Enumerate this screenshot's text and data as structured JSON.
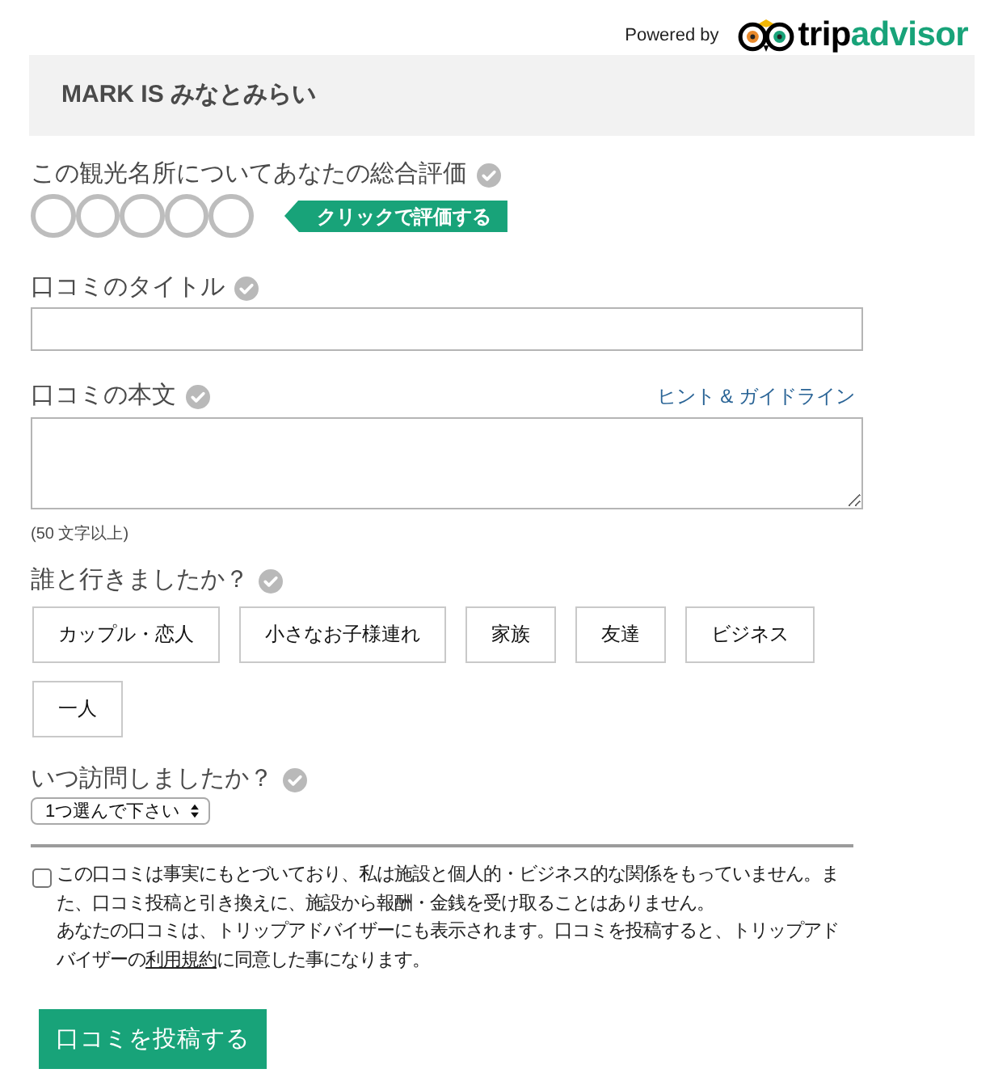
{
  "header": {
    "powered_by": "Powered by",
    "logo_parts": [
      "trip",
      "advisor"
    ]
  },
  "place": {
    "name": "MARK IS みなとみらい"
  },
  "rating": {
    "label": "この観光名所についてあなたの総合評価",
    "stars": 0,
    "prompt": "クリックで評価する"
  },
  "title_field": {
    "label": "口コミのタイトル"
  },
  "body_field": {
    "label": "口コミの本文",
    "link": "ヒント & ガイドライン",
    "hint": "(50 文字以上)"
  },
  "companions": {
    "label": "誰と行きましたか？",
    "options": [
      {
        "label": "カップル・恋人",
        "selected": false
      },
      {
        "label": "小さなお子様連れ",
        "selected": false
      },
      {
        "label": "家族",
        "selected": false
      },
      {
        "label": "友達",
        "selected": false
      },
      {
        "label": "ビジネス",
        "selected": false
      },
      {
        "label": "一人",
        "selected": false
      }
    ]
  },
  "visit_date": {
    "label": "いつ訪問しましたか？",
    "value": "1つ選んで下さい"
  },
  "agreement": {
    "checked": false,
    "text": "この口コミは事実にもとづいており、私は施設と個人的・ビジネス的な関係をもっていません。また、口コミ投稿と引き換えに、施設から報酬・金銭を受け取ることはありません。"
  },
  "notice": {
    "text_before": "あなたの口コミは、トリップアドバイザーにも表示されます。口コミを投稿すると、トリップアドバイザーの",
    "link": "利用規約",
    "text_after": "に同意した事になります。"
  },
  "submit": {
    "label": "口コミを投稿する"
  }
}
